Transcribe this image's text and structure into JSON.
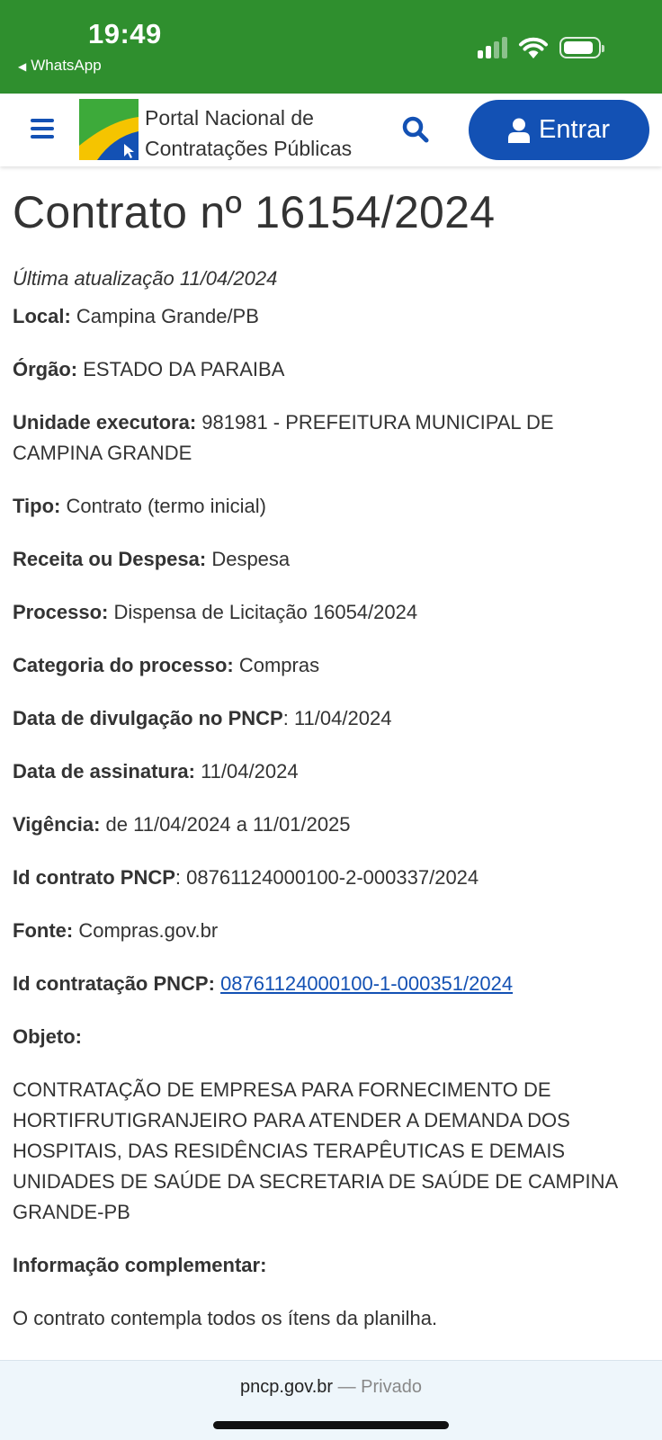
{
  "status_bar": {
    "time": "19:49",
    "back_app": "WhatsApp",
    "back_icon": "triangle-left-icon",
    "signal_bars": 4,
    "signal_strength": 2,
    "battery_level": 0.9,
    "color": "#2f8f2e"
  },
  "header": {
    "site_title_line1": "Portal Nacional de",
    "site_title_line2": "Contratações Públicas",
    "login_label": "Entrar",
    "accent_color": "#1351b4"
  },
  "page": {
    "title": "Contrato nº 16154/2024",
    "last_update": "Última atualização 11/04/2024"
  },
  "fields": [
    {
      "label": "Local:",
      "value": " Campina Grande/PB"
    },
    {
      "label": "Órgão:",
      "value": " ESTADO DA PARAIBA"
    },
    {
      "label": "Unidade executora:",
      "value": " 981981 - PREFEITURA MUNICIPAL DE CAMPINA GRANDE"
    },
    {
      "label": "Tipo:",
      "value": " Contrato (termo inicial)"
    },
    {
      "label": "Receita ou Despesa:",
      "value": " Despesa"
    },
    {
      "label": "Processo:",
      "value": " Dispensa de Licitação 16054/2024"
    },
    {
      "label": "Categoria do processo:",
      "value": " Compras"
    },
    {
      "label": "Data de divulgação no PNCP",
      "value": ": 11/04/2024"
    },
    {
      "label": "Data de assinatura:",
      "value": " 11/04/2024"
    },
    {
      "label": "Vigência:",
      "value": " de 11/04/2024 a 11/01/2025"
    },
    {
      "label": "Id contrato PNCP",
      "value": ": 08761124000100-2-000337/2024"
    },
    {
      "label": "Fonte:",
      "value": " Compras.gov.br"
    },
    {
      "label": "Id contratação PNCP:",
      "value": "08761124000100-1-000351/2024"
    },
    {
      "label": "Objeto:",
      "value": ""
    }
  ],
  "objeto_text": "CONTRATAÇÃO DE EMPRESA PARA FORNECIMENTO DE HORTIFRUTIGRANJEIRO PARA ATENDER A DEMANDA DOS HOSPITAIS, DAS RESIDÊNCIAS TERAPÊUTICAS E DEMAIS UNIDADES DE SAÚDE DA SECRETARIA DE SAÚDE DE CAMPINA GRANDE-PB",
  "info_label": "Informação complementar:",
  "info_text": "O contrato contempla todos os ítens da planilha.",
  "browser": {
    "domain": "pncp.gov.br",
    "separator": "—",
    "mode": "Privado"
  }
}
